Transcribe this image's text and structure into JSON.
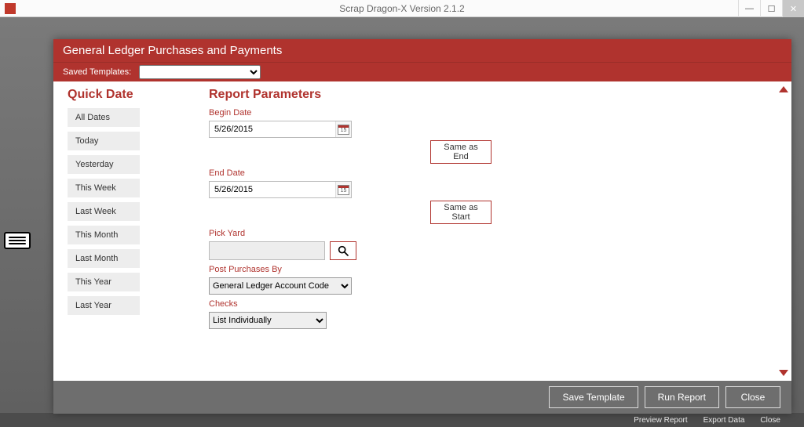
{
  "window": {
    "title": "Scrap Dragon-X  Version 2.1.2"
  },
  "statusbar": {
    "left_obscured": "",
    "items": [
      "Preview Report",
      "Export Data",
      "Close"
    ]
  },
  "modal": {
    "title": "General Ledger Purchases and Payments",
    "saved_templates_label": "Saved Templates:",
    "saved_templates_value": ""
  },
  "quick_date": {
    "heading": "Quick Date",
    "items": [
      "All Dates",
      "Today",
      "Yesterday",
      "This Week",
      "Last Week",
      "This Month",
      "Last Month",
      "This Year",
      "Last Year"
    ]
  },
  "params": {
    "heading": "Report Parameters",
    "begin_date_label": "Begin Date",
    "begin_date_value": "5/26/2015",
    "same_as_end": "Same as End",
    "end_date_label": "End Date",
    "end_date_value": "5/26/2015",
    "same_as_start": "Same as Start",
    "pick_yard_label": "Pick Yard",
    "pick_yard_value": "",
    "post_by_label": "Post Purchases By",
    "post_by_value": "General Ledger Account Code",
    "checks_label": "Checks",
    "checks_value": "List Individually"
  },
  "footer": {
    "save_template": "Save Template",
    "run_report": "Run Report",
    "close": "Close"
  }
}
